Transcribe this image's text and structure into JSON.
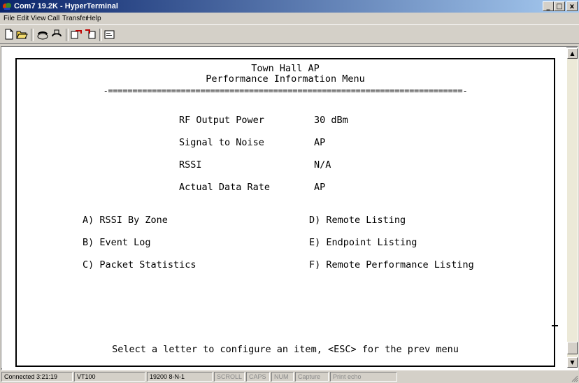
{
  "window": {
    "title": "Com7 19.2K - HyperTerminal",
    "controls": {
      "minimize": "_",
      "maximize": "□",
      "close": "x"
    }
  },
  "menubar": {
    "items": [
      {
        "label": "File",
        "key": "F"
      },
      {
        "label": "Edit",
        "key": "E"
      },
      {
        "label": "View",
        "key": "V"
      },
      {
        "label": "Call",
        "key": "C"
      },
      {
        "label": "Transfer",
        "key": "T"
      },
      {
        "label": "Help",
        "key": "H"
      }
    ]
  },
  "toolbar": {
    "buttons": [
      "new-file-icon",
      "open-folder-icon",
      "call-icon",
      "disconnect-icon",
      "send-icon",
      "receive-icon",
      "properties-icon"
    ]
  },
  "terminal": {
    "title1": "Town Hall AP",
    "title2": "Performance Information Menu",
    "separator": "-=========================================================================-",
    "stats": [
      {
        "label": "RF Output Power",
        "value": "30 dBm"
      },
      {
        "label": "Signal to Noise",
        "value": "AP"
      },
      {
        "label": "RSSI",
        "value": "N/A"
      },
      {
        "label": "Actual Data Rate",
        "value": "AP"
      }
    ],
    "options_left": [
      "A) RSSI By Zone",
      "B) Event Log",
      "C) Packet Statistics"
    ],
    "options_right": [
      "D) Remote Listing",
      "E) Endpoint Listing",
      "F) Remote Performance Listing"
    ],
    "prompt": "Select a letter to configure an item, <ESC> for the prev menu"
  },
  "statusbar": {
    "connected": "Connected 3:21:19",
    "emulation": "VT100",
    "port_settings": "19200 8-N-1",
    "scroll": "SCROLL",
    "caps": "CAPS",
    "num": "NUM",
    "capture": "Capture",
    "print_echo": "Print echo"
  },
  "colors": {
    "titlebar_start": "#0a246a",
    "titlebar_end": "#a6caf0",
    "chrome": "#d4d0c8",
    "terminal_bg": "#ffffff",
    "terminal_fg": "#000000"
  }
}
